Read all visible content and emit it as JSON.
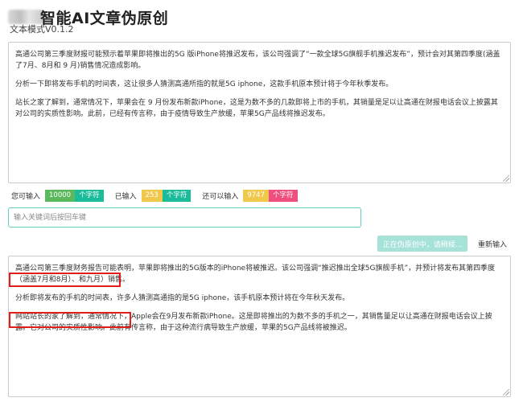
{
  "header": {
    "title": "智能AI文章伪原创",
    "version": "文本模式V0.1.2"
  },
  "input": {
    "paragraphs": [
      "高通公司第三季度财报可能预示着苹果即将推出的5G 版iPhone将推迟发布，该公司强调了“一款全球5G旗舰手机推迟发布”，预计会对其第四季度(涵盖了7月、8月和 9 月)销售情况造成影响。",
      "分析一下即将发布手机的时间表，这让很多人猜测高通所指的就是5G iphone，这款手机原本预计将于今年秋季发布。",
      "站长之家了解到，通常情况下，苹果会在 9 月份发布新款iPhone，这是为数不多的几款即将上市的手机，其销量是足以让高通在财报电话会议上披露其对公司的实质性影响。此前，已经有传言称，由于疫情导致生产放缓，苹果5G产品线将推迟发布。"
    ]
  },
  "stats": {
    "available_label": "您可输入",
    "available_value": "10000",
    "available_unit": "个字符",
    "entered_label": "已输入",
    "entered_value": "253",
    "entered_unit": "个字符",
    "remaining_label": "还可以输入",
    "remaining_value": "9747",
    "remaining_unit": "个字符"
  },
  "keyword": {
    "placeholder": "输入关键词后按回车键",
    "value": ""
  },
  "buttons": {
    "processing": "正在伪原创中，请稍候...",
    "reset": "重新输入"
  },
  "output": {
    "paragraphs": [
      "高通公司第三季度财务报告可能表明，苹果即将推出的5G版本的iPhone将被推迟。该公司强调“推迟推出全球5G旗舰手机”，并预计将发布其第四季度（涵盖7月和8月）、和九月）销售。",
      "分析即将发布的手机的时间表，许多人猜测高通指的是5G iphone，该手机原本预计将在今年秋天发布。",
      "网站站长的家了解到，通常情况下，Apple会在9月发布新款iPhone。这是即将推出的为数不多的手机之一，其销售量足以让高通在财报电话会议上披露。它对公司的实质性影响。此前有传言称，由于这种流行病导致生产放缓，苹果的5G产品线将被推迟。"
    ]
  },
  "colors": {
    "accent": "#1bbc9b",
    "highlight_border": "#e11d1d"
  }
}
